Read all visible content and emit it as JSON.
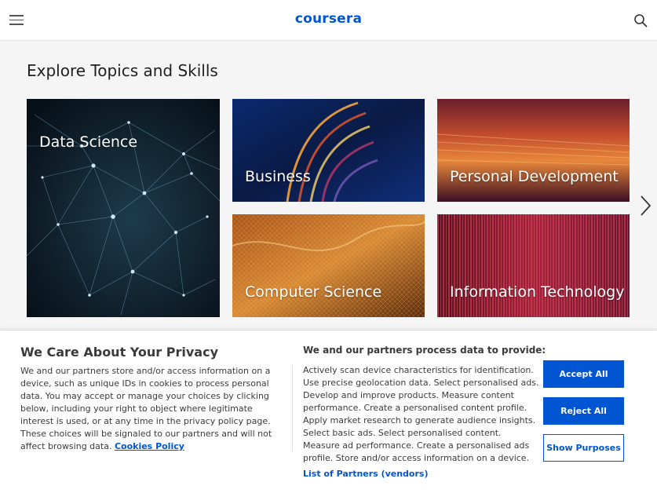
{
  "header": {
    "logo_text": "coursera",
    "menu_icon": "hamburger-menu-icon",
    "search_icon": "search-icon",
    "brand_color": "#0056d2"
  },
  "section": {
    "title": "Explore Topics and Skills"
  },
  "topics": [
    {
      "label": "Data Science"
    },
    {
      "label": "Business"
    },
    {
      "label": "Personal Development"
    },
    {
      "label": "Computer Science"
    },
    {
      "label": "Information Technology"
    }
  ],
  "carousel": {
    "next_icon": "chevron-right-icon"
  },
  "privacy": {
    "title": "We Care About Your Privacy",
    "body": "We and our partners store and/or access information on a device, such as unique IDs in cookies to process personal data. You may accept or manage your choices by clicking below, including your right to object where legitimate interest is used, or at any time in the privacy policy page. These choices will be signaled to our partners and will not affect browsing data.",
    "cookies_link": "Cookies Policy",
    "purposes_title": "We and our partners process data to provide:",
    "purposes_text": "Actively scan device characteristics for identification. Use precise geolocation data. Select personalised ads. Develop and improve products. Measure content performance. Create a personalised content profile. Apply market research to generate audience insights. Select basic ads. Select personalised content. Measure ad performance. Create a personalised ads profile. Store and/or access information on a device.",
    "partners_link": "List of Partners (vendors)",
    "accept_label": "Accept All",
    "reject_label": "Reject All",
    "show_purposes_label": "Show Purposes"
  }
}
